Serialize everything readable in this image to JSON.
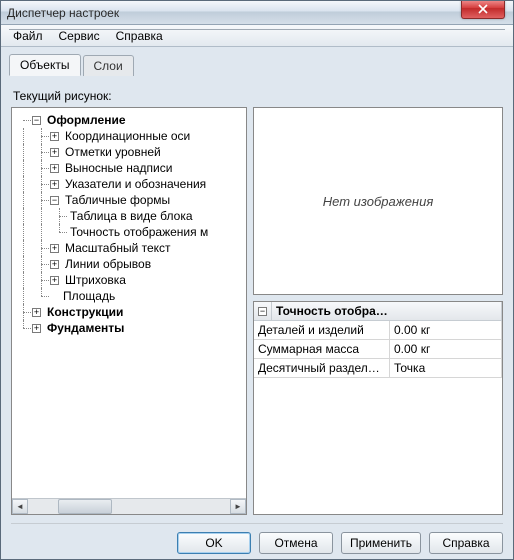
{
  "window": {
    "title": "Диспетчер настроек"
  },
  "menubar": {
    "file": "Файл",
    "service": "Сервис",
    "help": "Справка"
  },
  "tabs": {
    "objects": "Объекты",
    "layers": "Слои"
  },
  "content": {
    "current_drawing_label": "Текущий рисунок:"
  },
  "tree": {
    "root": "Оформление",
    "items": {
      "coord_axes": "Координационные оси",
      "level_marks": "Отметки уровней",
      "leaders": "Выносные надписи",
      "pointers": "Указатели и обозначения",
      "table_forms": "Табличные формы",
      "table_block": "Таблица в виде блока",
      "precision_disp": "Точность отображения м",
      "scale_text": "Масштабный текст",
      "break_lines": "Линии обрывов",
      "hatching": "Штриховка",
      "area": "Площадь"
    },
    "constructions": "Конструкции",
    "foundations": "Фундаменты"
  },
  "preview": {
    "no_image": "Нет изображения"
  },
  "grid": {
    "title": "Точность отобра…",
    "rows": [
      {
        "key": "Деталей и изделий",
        "val": "0.00 кг"
      },
      {
        "key": "Суммарная масса",
        "val": "0.00 кг"
      },
      {
        "key": "Десятичный раздели…",
        "val": "Точка"
      }
    ]
  },
  "buttons": {
    "ok": "OK",
    "cancel": "Отмена",
    "apply": "Применить",
    "help": "Справка"
  }
}
